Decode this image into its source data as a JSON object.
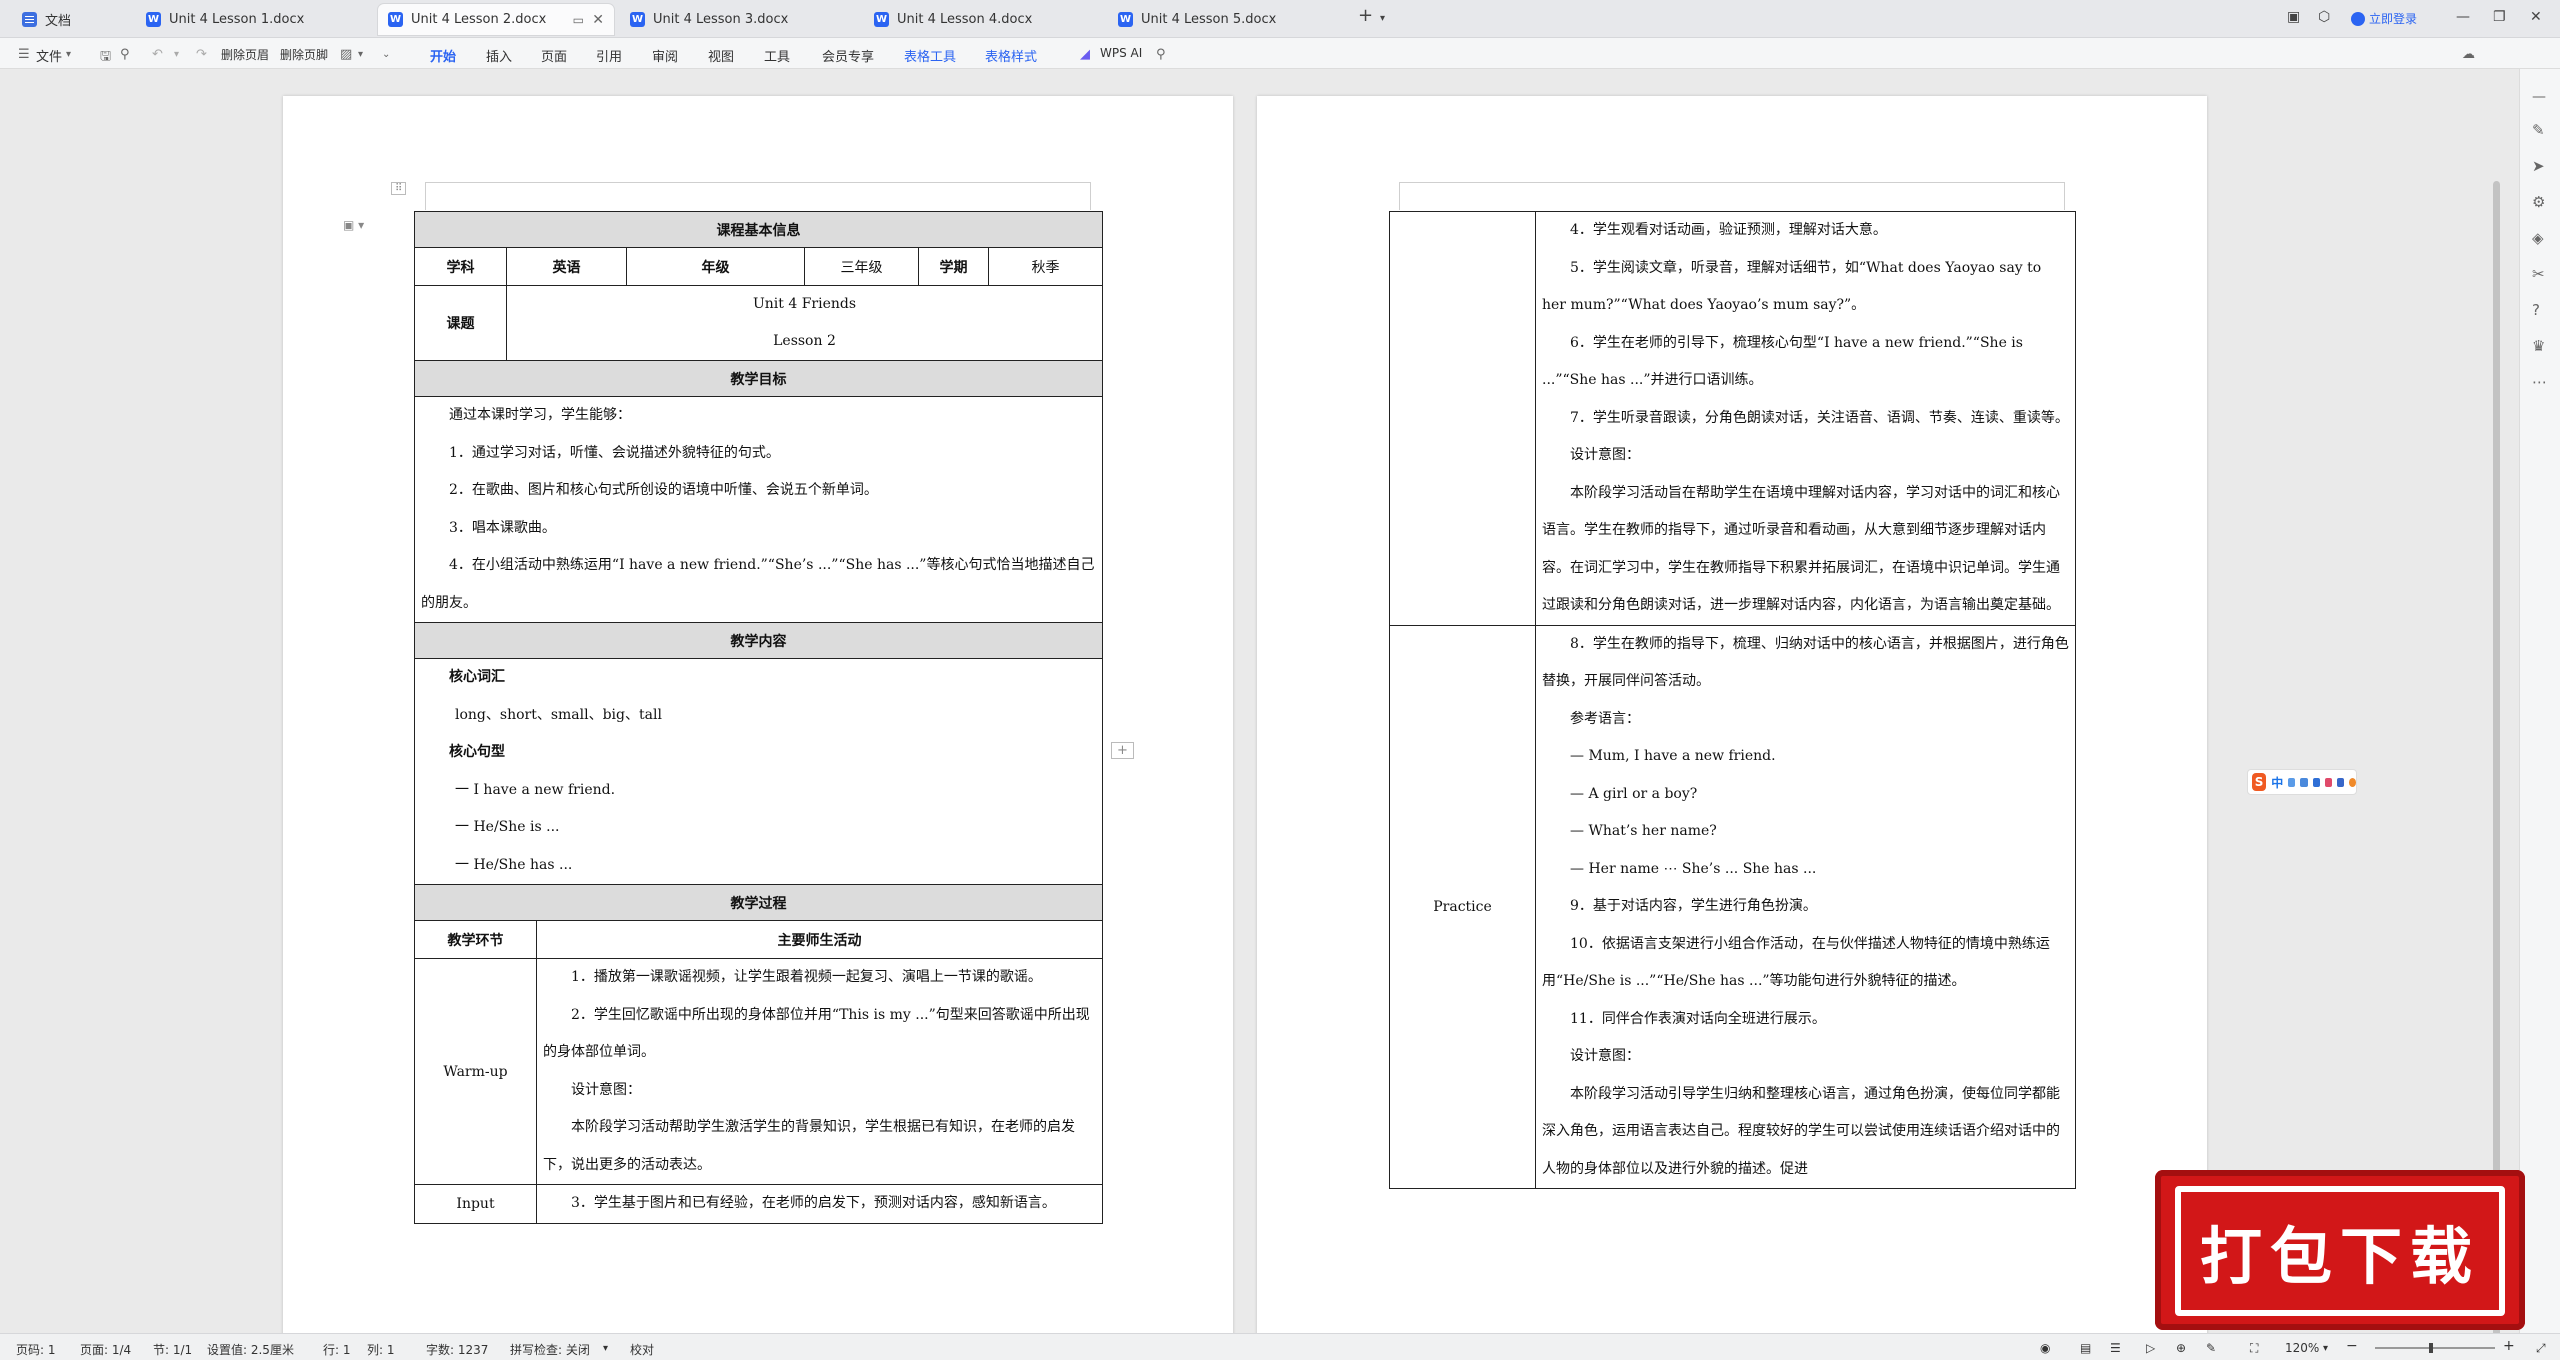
{
  "tabs": [
    {
      "label": "文档",
      "active": false
    },
    {
      "label": "Unit 4 Lesson 1.docx",
      "active": false
    },
    {
      "label": "Unit 4 Lesson 2.docx",
      "active": true
    },
    {
      "label": "Unit 4 Lesson 3.docx",
      "active": false
    },
    {
      "label": "Unit 4 Lesson 4.docx",
      "active": false
    },
    {
      "label": "Unit 4 Lesson 5.docx",
      "active": false
    }
  ],
  "titlebar": {
    "login": "立即登录",
    "share": "分享"
  },
  "ribbon": {
    "file": "文件",
    "del_header": "删除页眉",
    "del_footer": "删除页脚",
    "menus": [
      "开始",
      "插入",
      "页面",
      "引用",
      "审阅",
      "视图",
      "工具",
      "会员专享",
      "表格工具",
      "表格样式"
    ],
    "wps_ai": "WPS AI"
  },
  "doc": {
    "basic_info": "课程基本信息",
    "subject_label": "学科",
    "subject": "英语",
    "grade_label": "年级",
    "grade": "三年级",
    "term_label": "学期",
    "term": "秋季",
    "topic_label": "课题",
    "topic_line1": "Unit 4 Friends",
    "topic_line2": "Lesson 2",
    "goals_header": "教学目标",
    "goals": [
      "通过本课时学习，学生能够：",
      "1．通过学习对话，听懂、会说描述外貌特征的句式。",
      "2．在歌曲、图片和核心句式所创设的语境中听懂、会说五个新单词。",
      "3．唱本课歌曲。",
      "4．在小组活动中熟练运用“I have a new friend.”“She’s ...”“She has ...”等核心句式恰当地描述自己的朋友。"
    ],
    "content_header": "教学内容",
    "vocab_title": "核心词汇",
    "vocab": "long、short、small、big、tall",
    "sentence_title": "核心句型",
    "sentences": [
      "一   I have a new friend.",
      "一   He/She is ...",
      "一   He/She has ..."
    ],
    "process_header": "教学过程",
    "col_stage": "教学环节",
    "col_activity": "主要师生活动",
    "warmup_label": "Warm-up",
    "warmup": [
      "1．播放第一课歌谣视频，让学生跟着视频一起复习、演唱上一节课的歌谣。",
      "2．学生回忆歌谣中所出现的身体部位并用“This is my ...”句型来回答歌谣中所出现的身体部位单词。",
      "设计意图：",
      "本阶段学习活动帮助学生激活学生的背景知识，学生根据已有知识，在老师的启发下，说出更多的活动表达。"
    ],
    "input_label": "Input",
    "input": [
      "3．学生基于图片和已有经验，在老师的启发下，预测对话内容，感知新语言。"
    ],
    "input_cont": [
      "4．学生观看对话动画，验证预测，理解对话大意。",
      "5．学生阅读文章，听录音，理解对话细节，如“What does Yaoyao say to her mum?”“What does Yaoyao’s mum say?”。",
      "6．学生在老师的引导下，梳理核心句型“I have a new friend.”“She is ...”“She has ...”并进行口语训练。",
      "7．学生听录音跟读，分角色朗读对话，关注语音、语调、节奏、连读、重读等。",
      "设计意图：",
      "本阶段学习活动旨在帮助学生在语境中理解对话内容，学习对话中的词汇和核心语言。学生在教师的指导下，通过听录音和看动画，从大意到细节逐步理解对话内容。在词汇学习中，学生在教师指导下积累并拓展词汇，在语境中识记单词。学生通过跟读和分角色朗读对话，进一步理解对话内容，内化语言，为语言输出奠定基础。"
    ],
    "practice_label": "Practice",
    "practice": [
      "8．学生在教师的指导下，梳理、归纳对话中的核心语言，并根据图片，进行角色替换，开展同伴问答活动。",
      "参考语言：",
      "— Mum, I have a new friend.",
      "— A girl or a boy?",
      "— What’s her name?",
      "— Her name ⋯ She’s ... She has ...",
      "9．基于对话内容，学生进行角色扮演。",
      "10．依据语言支架进行小组合作活动，在与伙伴描述人物特征的情境中熟练运用“He/She is ...”“He/She has ...”等功能句进行外貌特征的描述。",
      "11．同伴合作表演对话向全班进行展示。",
      "设计意图：",
      "本阶段学习活动引导学生归纳和整理核心语言，通过角色扮演，使每位同学都能深入角色，运用语言表达自己。程度较好的学生可以尝试使用连续话语介绍对话中的人物的身体部位以及进行外貌的描述。促进"
    ]
  },
  "ime": {
    "label": "中"
  },
  "banner": {
    "text": "打包下载"
  },
  "status": {
    "page_no": "页码: 1",
    "pages": "页面: 1/4",
    "section": "节: 1/1",
    "setting": "设置值: 2.5厘米",
    "row": "行: 1",
    "col": "列: 1",
    "words": "字数: 1237",
    "spell": "拼写检查: 关闭",
    "proof": "校对",
    "zoom": "120%"
  }
}
